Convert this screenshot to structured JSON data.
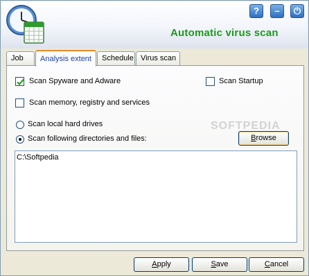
{
  "header": {
    "title": "Automatic virus scan",
    "help_glyph": "?",
    "minimize_glyph": "–",
    "power_glyph": "⏻",
    "title_color": "#1a9b1a"
  },
  "tabs": [
    {
      "label": "Job",
      "active": false
    },
    {
      "label": "Analysis extent",
      "active": true
    },
    {
      "label": "Schedule",
      "active": false
    },
    {
      "label": "Virus scan",
      "active": false
    }
  ],
  "options": {
    "spyware": {
      "label": "Scan Spyware and Adware",
      "checked": true
    },
    "startup": {
      "label": "Scan Startup",
      "checked": false
    },
    "memory": {
      "label": "Scan memory, registry and services",
      "checked": false
    },
    "local_drives": {
      "label": "Scan local hard drives",
      "selected": false
    },
    "dirs": {
      "label": "Scan following directories and files:",
      "selected": true
    }
  },
  "browse": {
    "label_rest": "rowse",
    "label_key": "B"
  },
  "dir_list": [
    "C:\\Softpedia"
  ],
  "watermark": "SOFTPEDIA",
  "footer": {
    "apply": {
      "key": "A",
      "rest": "pply"
    },
    "save": {
      "key": "S",
      "rest": "ave"
    },
    "cancel": {
      "key": "C",
      "rest": "ancel"
    }
  },
  "icons": {
    "app": "clock-calendar-icon",
    "help": "help-icon",
    "minimize": "minimize-icon",
    "power": "power-icon"
  }
}
